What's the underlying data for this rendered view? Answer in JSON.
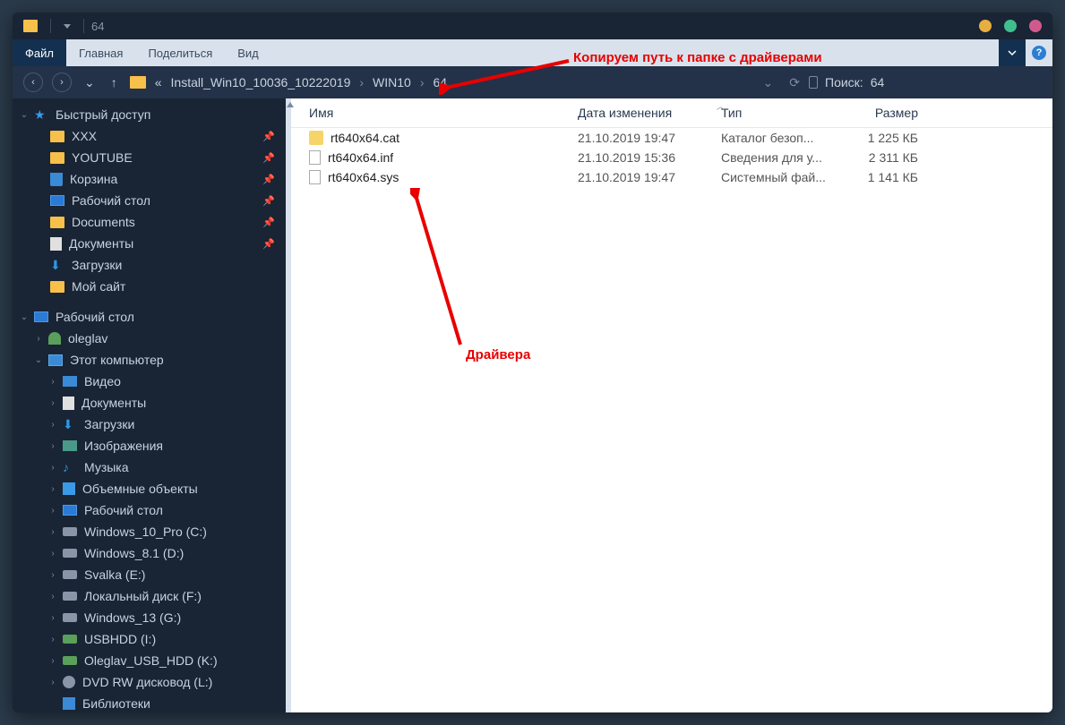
{
  "title": "64",
  "menu": {
    "file": "Файл",
    "home": "Главная",
    "share": "Поделиться",
    "view": "Вид"
  },
  "breadcrumb": {
    "prefix": "«",
    "items": [
      "Install_Win10_10036_10222019",
      "WIN10",
      "64"
    ]
  },
  "search": {
    "label": "Поиск:",
    "value": "64"
  },
  "sidebar": {
    "quick": {
      "label": "Быстрый доступ",
      "items": [
        {
          "label": "XXX",
          "icon": "folder",
          "pin": true
        },
        {
          "label": "YOUTUBE",
          "icon": "folder",
          "pin": true
        },
        {
          "label": "Корзина",
          "icon": "trash",
          "pin": true
        },
        {
          "label": "Рабочий стол",
          "icon": "desktop",
          "pin": true
        },
        {
          "label": "Documents",
          "icon": "folder",
          "pin": true
        },
        {
          "label": "Документы",
          "icon": "doc",
          "pin": true
        },
        {
          "label": "Загрузки",
          "icon": "down",
          "pin": false
        },
        {
          "label": "Мой сайт",
          "icon": "folder",
          "pin": false
        }
      ]
    },
    "desktop": {
      "label": "Рабочий стол"
    },
    "user": {
      "label": "oleglav"
    },
    "thispc": {
      "label": "Этот компьютер",
      "items": [
        {
          "label": "Видео",
          "icon": "video"
        },
        {
          "label": "Документы",
          "icon": "doc"
        },
        {
          "label": "Загрузки",
          "icon": "down"
        },
        {
          "label": "Изображения",
          "icon": "img"
        },
        {
          "label": "Музыка",
          "icon": "music"
        },
        {
          "label": "Объемные объекты",
          "icon": "3d"
        },
        {
          "label": "Рабочий стол",
          "icon": "desktop"
        },
        {
          "label": "Windows_10_Pro (C:)",
          "icon": "drive"
        },
        {
          "label": "Windows_8.1 (D:)",
          "icon": "drive"
        },
        {
          "label": "Svalka (E:)",
          "icon": "drive"
        },
        {
          "label": "Локальный диск (F:)",
          "icon": "drive"
        },
        {
          "label": "Windows_13 (G:)",
          "icon": "drive"
        },
        {
          "label": "USBHDD (I:)",
          "icon": "usb"
        },
        {
          "label": "Oleglav_USB_HDD (K:)",
          "icon": "usb"
        },
        {
          "label": "DVD RW дисковод (L:)",
          "icon": "dvd"
        },
        {
          "label": "Библиотеки",
          "icon": "lib"
        }
      ]
    }
  },
  "columns": {
    "name": "Имя",
    "date": "Дата изменения",
    "type": "Тип",
    "size": "Размер"
  },
  "files": [
    {
      "name": "rt640x64.cat",
      "date": "21.10.2019 19:47",
      "type": "Каталог безоп...",
      "size": "1 225 КБ",
      "icon": "cat"
    },
    {
      "name": "rt640x64.inf",
      "date": "21.10.2019 15:36",
      "type": "Сведения для у...",
      "size": "2 311 КБ",
      "icon": "inf"
    },
    {
      "name": "rt640x64.sys",
      "date": "21.10.2019 19:47",
      "type": "Системный фай...",
      "size": "1 141 КБ",
      "icon": "sys"
    }
  ],
  "annotations": {
    "top": "Копируем путь к папке с драйверами",
    "bottom": "Драйвера"
  }
}
